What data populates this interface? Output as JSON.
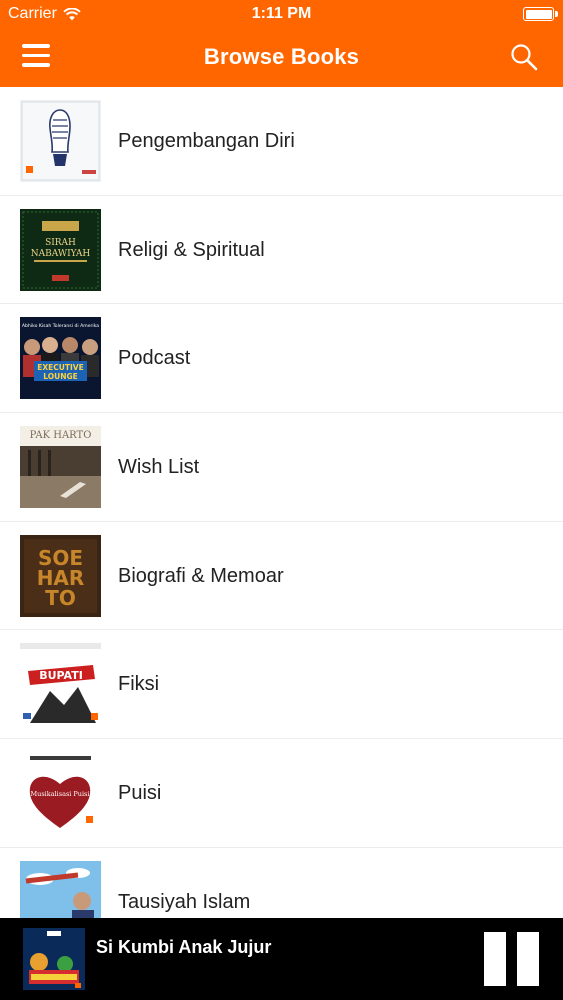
{
  "status_bar": {
    "carrier": "Carrier",
    "time": "1:11 PM",
    "battery_level": 1.0
  },
  "nav": {
    "title": "Browse Books",
    "menu_icon": "hamburger-menu-icon",
    "search_icon": "search-icon"
  },
  "categories": [
    {
      "label": "Pengembangan Diri",
      "cover_theme": "white"
    },
    {
      "label": "Religi & Spiritual",
      "cover_theme": "dark-green"
    },
    {
      "label": "Podcast",
      "cover_theme": "navy"
    },
    {
      "label": "Wish List",
      "cover_theme": "sepia"
    },
    {
      "label": "Biografi & Memoar",
      "cover_theme": "brown"
    },
    {
      "label": "Fiksi",
      "cover_theme": "white-red"
    },
    {
      "label": "Puisi",
      "cover_theme": "white-heart"
    },
    {
      "label": "Tausiyah Islam",
      "cover_theme": "sky"
    }
  ],
  "cover_texts": {
    "religi_top": "SIRAH",
    "religi_bottom": "NABAWIYAH",
    "podcast_header": "Abhiko Kisah Toleransi di Amerika",
    "podcast_logo_1": "EXECUTIVE",
    "podcast_logo_2": "LOUNGE",
    "wishlist_title": "PAK HARTO",
    "bio_1": "SOE",
    "bio_2": "HAR",
    "bio_3": "TO",
    "fiksi_title": "BUPATI",
    "puisi_title": "Musikalisasi Puisi"
  },
  "player": {
    "title": "Si Kumbi Anak Jujur",
    "state": "playing",
    "pause_icon": "pause-icon"
  },
  "colors": {
    "brand": "#ff6600",
    "player_bg": "#000000",
    "text": "#222222"
  }
}
